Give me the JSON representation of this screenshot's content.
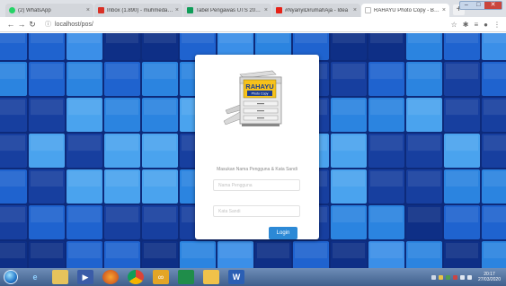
{
  "browser": {
    "tabs": [
      {
        "title": "(2) WhatsApp",
        "icon": "whatsapp-icon",
        "color": "#25d366",
        "active": false
      },
      {
        "title": "Inbox (1.890) - muhmeda@bu",
        "icon": "gmail-icon",
        "color": "#d93025",
        "active": false
      },
      {
        "title": "Tabel Pengawas UTS 2020 - Go",
        "icon": "sheets-icon",
        "color": "#0f9d58",
        "active": false
      },
      {
        "title": "#NyanyiDirumahAja - Idea",
        "icon": "youtube-icon",
        "color": "#e62117",
        "active": false
      },
      {
        "title": "RAHAYU Photo Copy - Bootstr",
        "icon": "page-icon",
        "color": "#bfbfbf",
        "active": true
      }
    ],
    "new_tab": "+",
    "url": "localhost/pos/",
    "window_controls": {
      "minimize": "–",
      "maximize": "□",
      "close": "✕"
    }
  },
  "login": {
    "logo_brand": "RAHAYU",
    "logo_sub": "Photo Copy",
    "instruction": "Masukan Nama Pengguna & Kata Sandi",
    "username_placeholder": "Nama Pengguna",
    "password_placeholder": "Kata Sandi",
    "login_button": "Login",
    "accent": "#2c89d6"
  },
  "taskbar": {
    "apps": [
      "start-orb",
      "ie-icon",
      "explorer-icon",
      "media-icon",
      "firefox-icon",
      "chrome-icon",
      "app-icon",
      "sheets-icon",
      "folder-icon",
      "word-icon"
    ],
    "clock_time": "20:17",
    "clock_date": "27/03/2020"
  }
}
